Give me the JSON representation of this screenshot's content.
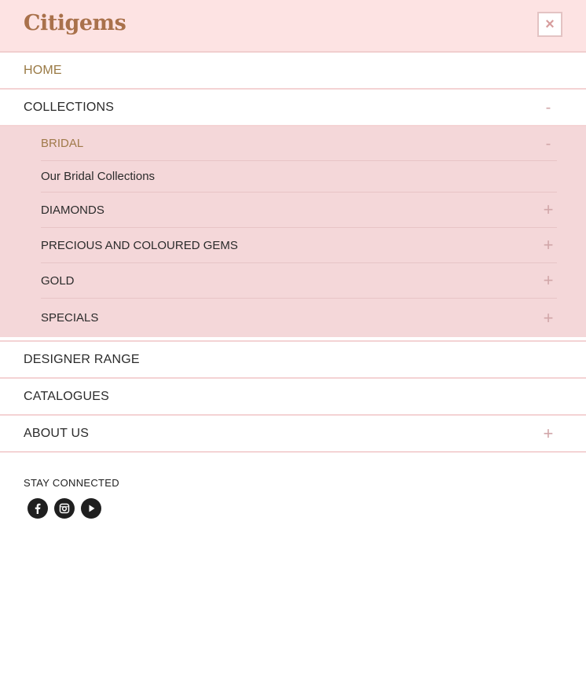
{
  "header": {
    "logo_text": "Citigems",
    "close_label": "×"
  },
  "menu": {
    "home": "HOME",
    "collections": "COLLECTIONS",
    "collections_toggle": "-",
    "designer_range": "DESIGNER RANGE",
    "catalogues": "CATALOGUES",
    "about_us": "ABOUT US",
    "about_toggle": "+"
  },
  "submenu": {
    "bridal": "BRIDAL",
    "bridal_toggle": "-",
    "bridal_child": "Our Bridal Collections",
    "diamonds": "DIAMONDS",
    "precious": "PRECIOUS AND COLOURED GEMS",
    "gold": "GOLD",
    "specials": "SPECIALS",
    "plus": "+"
  },
  "footer": {
    "stay_connected": "STAY CONNECTED"
  },
  "social_icons": [
    "facebook-icon",
    "instagram-icon",
    "youtube-icon"
  ],
  "colors": {
    "header_bg": "#fde3e3",
    "submenu_bg": "#f4d7d9",
    "logo": "#a9714b",
    "active_text": "#9a7a45",
    "toggle": "#d1a6a8"
  }
}
